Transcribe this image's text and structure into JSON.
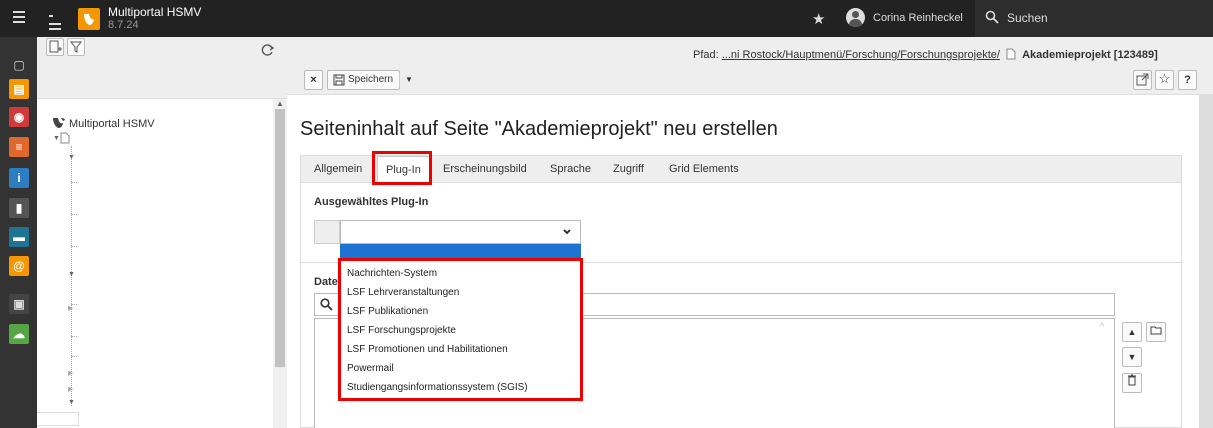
{
  "app": {
    "title": "Multiportal HSMV",
    "version": "8.7.24"
  },
  "user": {
    "name": "Corina Reinheckel"
  },
  "search": {
    "label": "Suchen"
  },
  "tree": {
    "root_label": "Multiportal HSMV"
  },
  "path": {
    "prefix": "Pfad:",
    "link": "...ni Rostock/Hauptmenü/Forschung/Forschungsprojekte/",
    "page": "Akademieprojekt [123489]"
  },
  "toolbar": {
    "close_label": "×",
    "save_label": "Speichern"
  },
  "page_title": "Seiteninhalt auf Seite \"Akademieprojekt\" neu erstellen",
  "tabs": [
    {
      "label": "Allgemein"
    },
    {
      "label": "Plug-In"
    },
    {
      "label": "Erscheinungsbild"
    },
    {
      "label": "Sprache"
    },
    {
      "label": "Zugriff"
    },
    {
      "label": "Grid Elements"
    }
  ],
  "plugin": {
    "heading": "Ausgewähltes Plug-In",
    "options": [
      "Nachrichten-System",
      "LSF Lehrveranstaltungen",
      "LSF Publikationen",
      "LSF Forschungsprojekte",
      "LSF Promotionen und Habilitationen",
      "Powermail",
      "Studiengangsinformationssystem (SGIS)"
    ]
  },
  "fileref": {
    "label": "Date"
  },
  "colors": {
    "topbar": "#222222",
    "accent": "#f49700",
    "selection": "#1e73d2",
    "highlight": "#e00000"
  }
}
